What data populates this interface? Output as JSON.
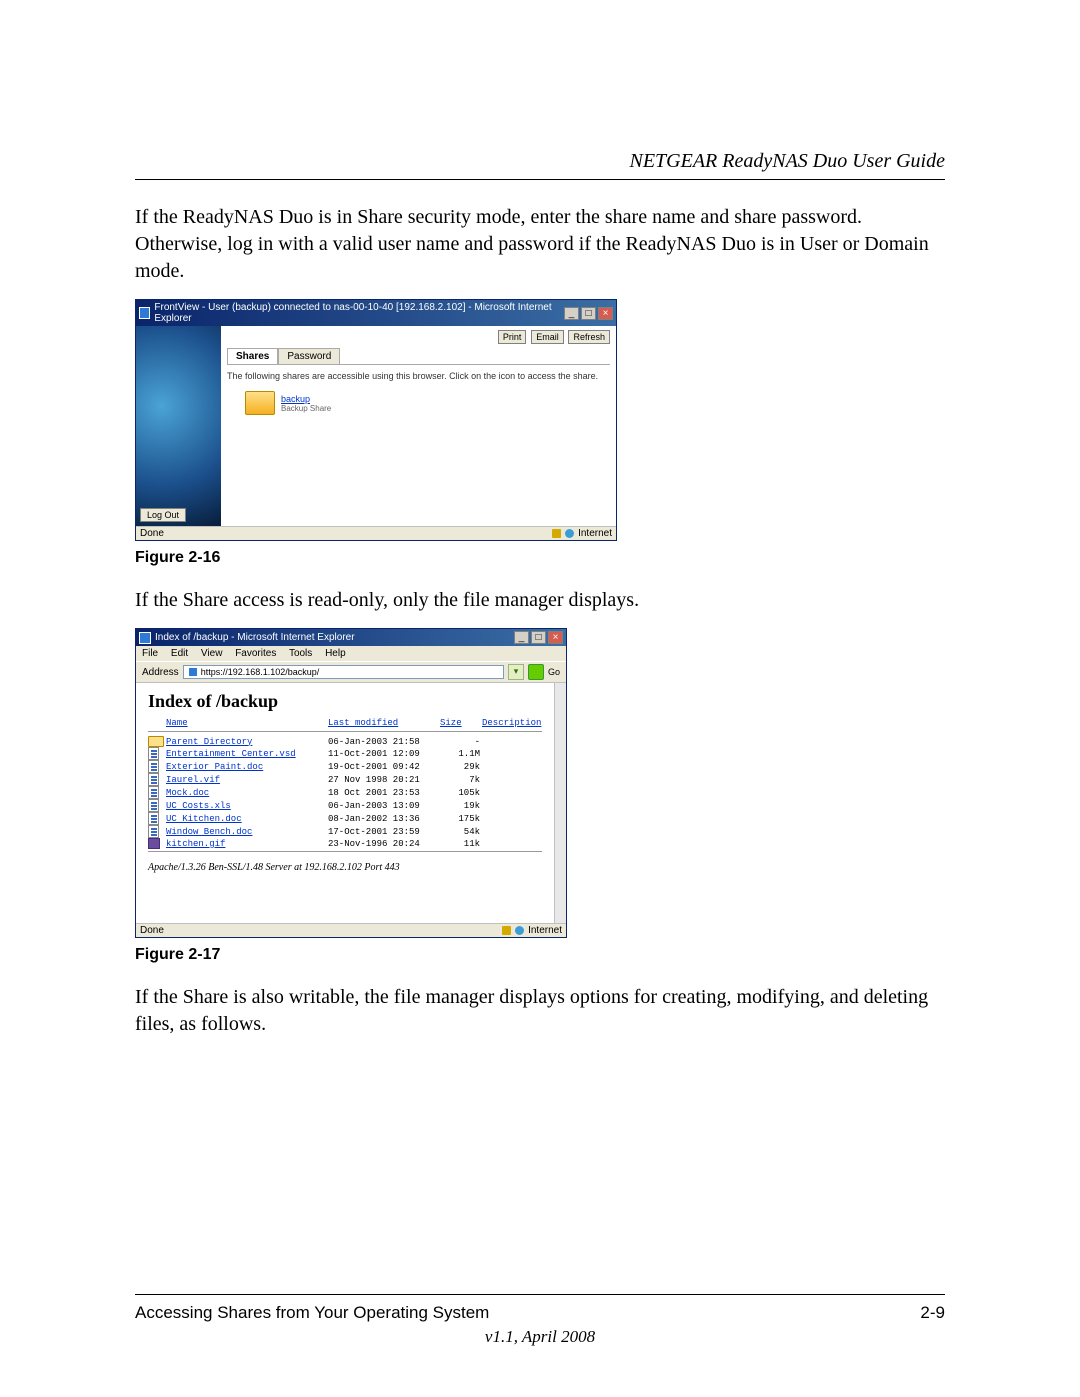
{
  "header": {
    "title": "NETGEAR ReadyNAS Duo User Guide"
  },
  "paragraphs": {
    "intro": "If the ReadyNAS Duo is in Share security mode, enter the share name and share password. Otherwise, log in with a valid user name and password if the ReadyNAS Duo is in User or Domain mode.",
    "readonly": "If the Share access is read-only, only the file manager displays.",
    "writable": "If the Share is also writable, the file manager displays options for creating, modifying, and deleting files, as follows."
  },
  "figures": {
    "f216": {
      "label": "Figure 2-16"
    },
    "f217": {
      "label": "Figure 2-17"
    }
  },
  "frontview": {
    "window_title": "FrontView - User (backup) connected to nas-00-10-40 [192.168.2.102] - Microsoft Internet Explorer",
    "buttons": {
      "print": "Print",
      "email": "Email",
      "refresh": "Refresh"
    },
    "tabs": {
      "shares": "Shares",
      "password": "Password"
    },
    "desc": "The following shares are accessible using this browser. Click on the icon to access the share.",
    "share": {
      "name": "backup",
      "sub": "Backup Share"
    },
    "logout": "Log Out",
    "status_left": "Done",
    "status_right": "Internet"
  },
  "index_window": {
    "window_title": "Index of /backup - Microsoft Internet Explorer",
    "menu": {
      "file": "File",
      "edit": "Edit",
      "view": "View",
      "favorites": "Favorites",
      "tools": "Tools",
      "help": "Help"
    },
    "address_label": "Address",
    "address_value": "https://192.168.1.102/backup/",
    "go_label": "Go",
    "heading": "Index of /backup",
    "columns": {
      "name": "Name",
      "modified": "Last modified",
      "size": "Size",
      "desc": "Description"
    },
    "rows": [
      {
        "icon": "dir",
        "name": "Parent Directory",
        "modified": "06-Jan-2003 21:58",
        "size": "-"
      },
      {
        "icon": "file",
        "name": "Entertainment Center.vsd",
        "modified": "11-Oct-2001 12:09",
        "size": "1.1M"
      },
      {
        "icon": "file",
        "name": "Exterior Paint.doc",
        "modified": "19-Oct-2001 09:42",
        "size": "29k"
      },
      {
        "icon": "file",
        "name": "Iaurel.vif",
        "modified": "27 Nov 1998 20:21",
        "size": "7k"
      },
      {
        "icon": "file",
        "name": "Mock.doc",
        "modified": "18 Oct 2001 23:53",
        "size": "105k"
      },
      {
        "icon": "file",
        "name": "UC Costs.xls",
        "modified": "06-Jan-2003 13:09",
        "size": "19k"
      },
      {
        "icon": "file",
        "name": "UC Kitchen.doc",
        "modified": "08-Jan-2002 13:36",
        "size": "175k"
      },
      {
        "icon": "file",
        "name": "Window Bench.doc",
        "modified": "17-Oct-2001 23:59",
        "size": "54k"
      },
      {
        "icon": "img",
        "name": "kitchen.gif",
        "modified": "23-Nov-1996 20:24",
        "size": "11k"
      }
    ],
    "server_line": "Apache/1.3.26 Ben-SSL/1.48 Server at 192.168.2.102 Port 443",
    "status_left": "Done",
    "status_right": "Internet"
  },
  "footer": {
    "left": "Accessing Shares from Your Operating System",
    "right": "2-9",
    "version": "v1.1, April 2008"
  }
}
